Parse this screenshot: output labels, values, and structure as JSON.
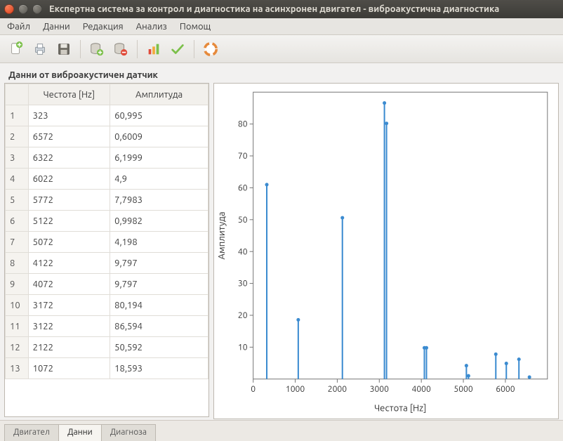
{
  "window": {
    "title": "Експертна система за контрол и диагностика на асинхронен двигател - виброакустична диагностика"
  },
  "menu": {
    "file": "Файл",
    "data": "Данни",
    "edit": "Редакция",
    "analysis": "Анализ",
    "help": "Помощ"
  },
  "panel": {
    "header": "Данни от виброакустичен датчик"
  },
  "table": {
    "columns": {
      "freq": "Честота [Hz]",
      "amp": "Амплитуда"
    },
    "rows": [
      {
        "idx": "1",
        "freq": "323",
        "amp": "60,995"
      },
      {
        "idx": "2",
        "freq": "6572",
        "amp": "0,6009"
      },
      {
        "idx": "3",
        "freq": "6322",
        "amp": "6,1999"
      },
      {
        "idx": "4",
        "freq": "6022",
        "amp": "4,9"
      },
      {
        "idx": "5",
        "freq": "5772",
        "amp": "7,7983"
      },
      {
        "idx": "6",
        "freq": "5122",
        "amp": "0,9982"
      },
      {
        "idx": "7",
        "freq": "5072",
        "amp": "4,198"
      },
      {
        "idx": "8",
        "freq": "4122",
        "amp": "9,797"
      },
      {
        "idx": "9",
        "freq": "4072",
        "amp": "9,797"
      },
      {
        "idx": "10",
        "freq": "3172",
        "amp": "80,194"
      },
      {
        "idx": "11",
        "freq": "3122",
        "amp": "86,594"
      },
      {
        "idx": "12",
        "freq": "2122",
        "amp": "50,592"
      },
      {
        "idx": "13",
        "freq": "1072",
        "amp": "18,593"
      }
    ]
  },
  "chart_data": {
    "type": "bar",
    "x": [
      323,
      1072,
      2122,
      3122,
      3172,
      4072,
      4122,
      5072,
      5122,
      5772,
      6022,
      6322,
      6572
    ],
    "y": [
      60.995,
      18.593,
      50.592,
      86.594,
      80.194,
      9.797,
      9.797,
      4.198,
      0.9982,
      7.7983,
      4.9,
      6.1999,
      0.6009
    ],
    "xlabel": "Честота [Hz]",
    "ylabel": "Амплитуда",
    "xlim": [
      0,
      7000
    ],
    "ylim": [
      0,
      90
    ],
    "xticks": [
      0,
      1000,
      2000,
      3000,
      4000,
      5000,
      6000
    ],
    "yticks": [
      10,
      20,
      30,
      40,
      50,
      60,
      70,
      80
    ]
  },
  "tabs": {
    "engine": "Двигател",
    "data": "Данни",
    "diagnosis": "Диагноза",
    "active": "data"
  }
}
